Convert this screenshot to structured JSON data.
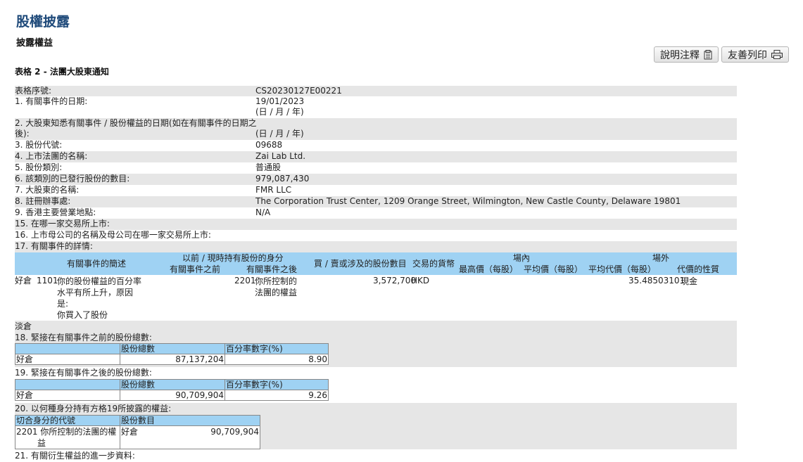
{
  "page": {
    "title": "股權披露",
    "subtitle": "披露權益",
    "table_title": "表格 2 - 法團大股東通知"
  },
  "buttons": {
    "explain": "說明注釋",
    "print": "友善列印"
  },
  "fields": {
    "serial_label": "表格序號:",
    "serial_value": "CS20230127E00221",
    "event_date_label": "1. 有關事件的日期:",
    "event_date_value": "19/01/2023",
    "event_date_fmt": "(日 / 月 / 年)",
    "aware_date_label_1": "2. 大股東知悉有關事件 / 股份權益的日期(如在有關事件的日期之",
    "aware_date_label_2": "後):",
    "aware_date_fmt": "(日 / 月 / 年)",
    "stock_code_label": "3. 股份代號:",
    "stock_code_value": "09688",
    "issuer_label": "4. 上市法團的名稱:",
    "issuer_value": "Zai Lab Ltd.",
    "class_label": "5. 股份類別:",
    "class_value": "普通股",
    "issued_label": "6. 該類別的已發行股份的數目:",
    "issued_value": "979,087,430",
    "holder_label": "7. 大股東的名稱:",
    "holder_value": "FMR LLC",
    "reg_office_label": "8. 註冊辦事處:",
    "reg_office_value": "The Corporation Trust Center, 1209 Orange Street, Wilmington, New Castle County, Delaware 19801",
    "hk_place_label": "9. 香港主要營業地點:",
    "hk_place_value": "N/A",
    "exchange_label": "15. 在哪一家交易所上市:",
    "parent_label": "16. 上市母公司的名稱及母公司在哪一家交易所上市:",
    "details_label": "17. 有關事件的詳情:"
  },
  "event_table": {
    "h_desc": "有關事件的簡述",
    "h_capacity": "以前 / 現時持有股份的身分",
    "h_before": "有關事件之前",
    "h_after": "有關事件之後",
    "h_shares": "買 / 賣或涉及的股份數目",
    "h_currency": "交易的貨幣",
    "h_onex": "場內",
    "h_high": "最高價（每股）",
    "h_avg": "平均價（每股）",
    "h_offex": "場外",
    "h_avg_off": "平均代價（每股）",
    "h_nature": "代價的性質",
    "row": {
      "position": "好倉",
      "code": "1101",
      "desc_1": "你的股份權益的百分率",
      "desc_2": "水平有所上升，原因",
      "desc_3": "是:",
      "desc_4": "你買入了股份",
      "after_code": "2201",
      "after_1": "你所控制的",
      "after_2": "法團的權益",
      "shares": "3,572,700",
      "currency": "HKD",
      "avg_off": "35.48503101",
      "nature": "現金"
    },
    "short_label": "淡倉"
  },
  "sec18": {
    "label": "18. 緊接在有關事件之前的股份總數:",
    "h_total": "股份總數",
    "h_pct": "百分率數字(%)",
    "row_label": "好倉",
    "total": "87,137,204",
    "pct": "8.90"
  },
  "sec19": {
    "label": "19. 緊接在有關事件之後的股份總數:",
    "h_total": "股份總數",
    "h_pct": "百分率數字(%)",
    "row_label": "好倉",
    "total": "90,709,904",
    "pct": "9.26"
  },
  "sec20": {
    "label": "20. 以何種身分持有方格19所披露的權益:",
    "h_code": "切合身分的代號",
    "h_count": "股份數目",
    "code": "2201",
    "desc_1": "你所控制的法團的權",
    "desc_2": "益",
    "position": "好倉",
    "count": "90,709,904"
  },
  "sec21": {
    "label": "21. 有關衍生權益的進一步資料:"
  },
  "colors": {
    "title": "#1f4a7a",
    "row_shade": "#e6e6e6",
    "header_blue": "#9fd2f3"
  }
}
